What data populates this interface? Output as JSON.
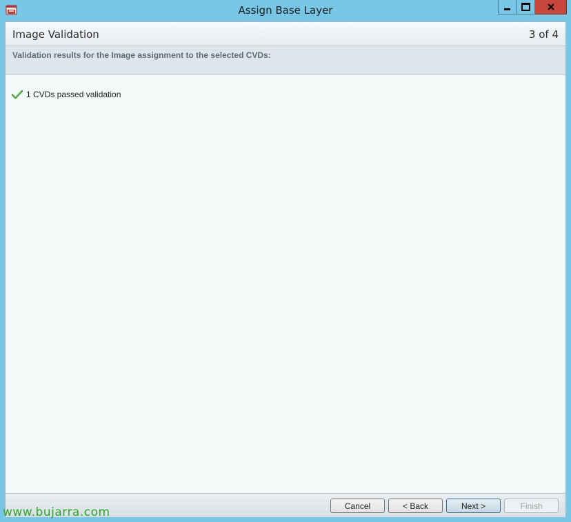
{
  "window": {
    "title": "Assign Base Layer"
  },
  "header": {
    "page_title": "Image Validation",
    "step": "3 of 4"
  },
  "subheader": {
    "text": "Validation results for the Image assignment to the selected CVDs:"
  },
  "results": [
    {
      "icon": "check-icon",
      "text": "1 CVDs passed validation",
      "status_color": "#3c9a2e"
    }
  ],
  "buttons": {
    "cancel": "Cancel",
    "back": "< Back",
    "next": "Next >",
    "finish": "Finish"
  },
  "watermark": "www.bujarra.com",
  "colors": {
    "chrome": "#79c7e6",
    "close_button": "#c7463c",
    "watermark": "#2fa52a"
  }
}
